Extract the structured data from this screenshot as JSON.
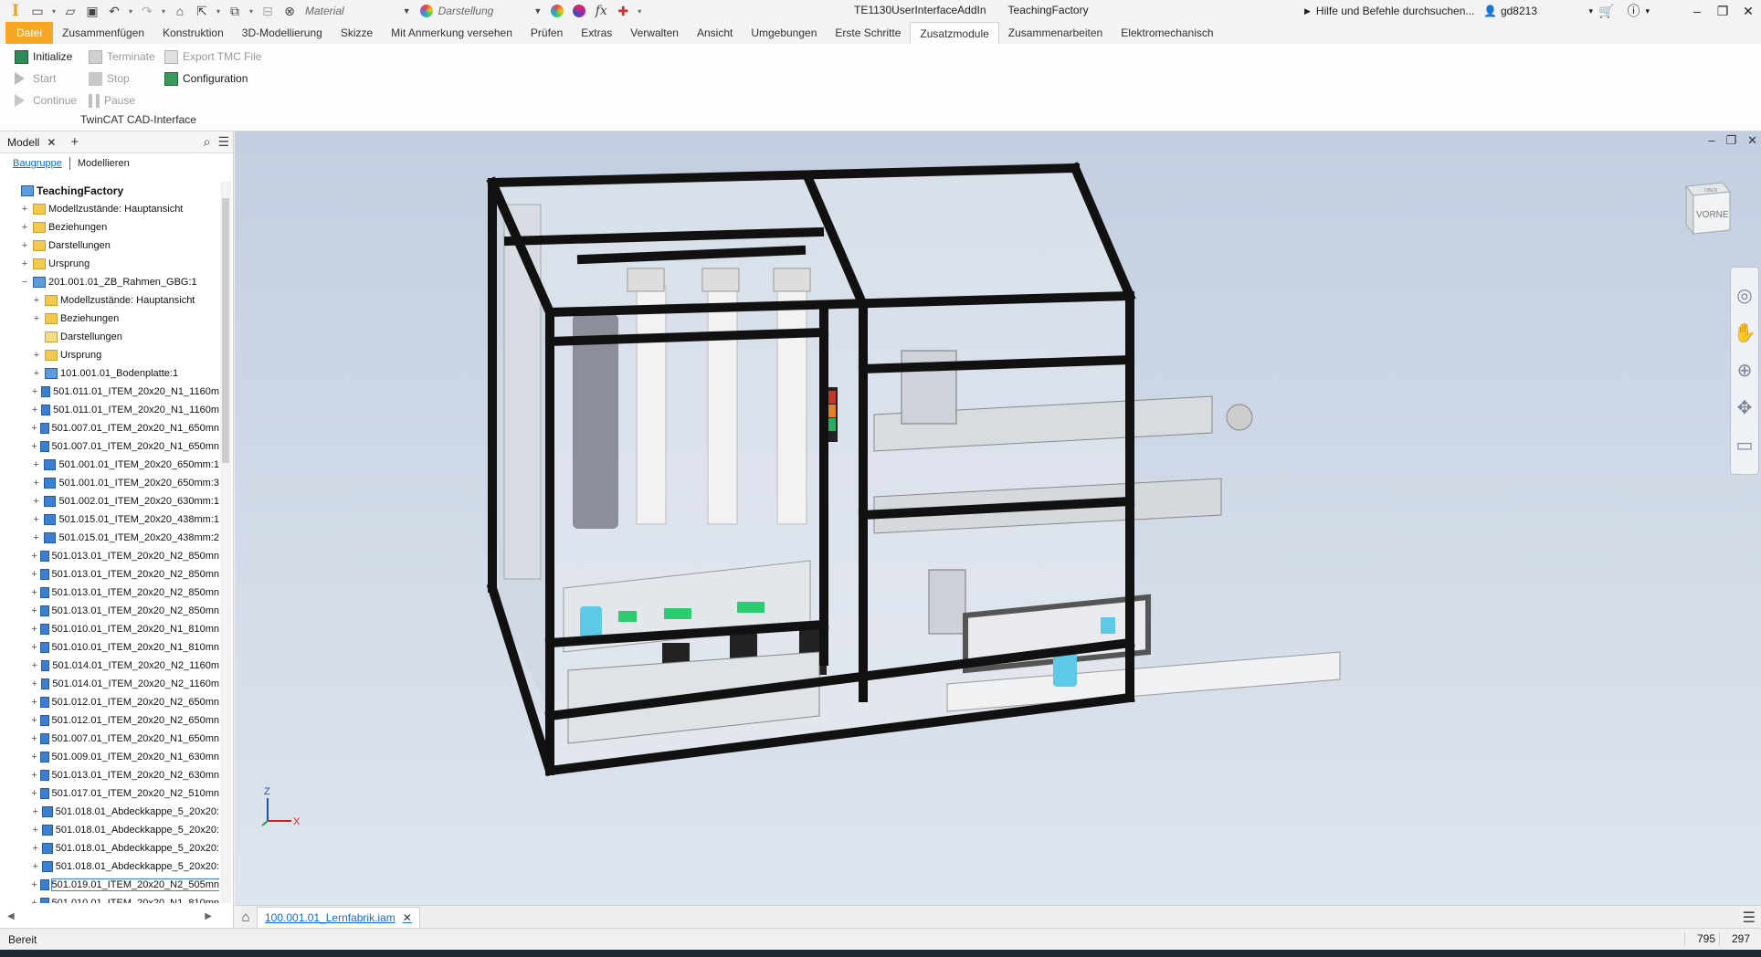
{
  "titlebar": {
    "material_label": "Material",
    "appearance_label": "Darstellung",
    "addin_name": "TE1130UserInterfaceAddIn",
    "document_title": "TeachingFactory",
    "help_search": "Hilfe und Befehle durchsuchen...",
    "user": "gd8213",
    "fx_label": "fx"
  },
  "menu": {
    "tabs": [
      "Datei",
      "Zusammenfügen",
      "Konstruktion",
      "3D-Modellierung",
      "Skizze",
      "Mit Anmerkung versehen",
      "Prüfen",
      "Extras",
      "Verwalten",
      "Ansicht",
      "Umgebungen",
      "Erste Schritte",
      "Zusatzmodule",
      "Zusammenarbeiten",
      "Elektromechanisch"
    ],
    "active": "Zusatzmodule"
  },
  "ribbon": {
    "initialize": "Initialize",
    "terminate": "Terminate",
    "export_tmc": "Export TMC File",
    "start": "Start",
    "stop": "Stop",
    "configuration": "Configuration",
    "continue": "Continue",
    "pause": "Pause",
    "group_label": "TwinCAT CAD-Interface"
  },
  "panel": {
    "tab_label": "Modell",
    "subtab_assembly": "Baugruppe",
    "subtab_modeling": "Modellieren",
    "tree": [
      {
        "label": "TeachingFactory",
        "level": 0,
        "icon": "asm",
        "exp": "",
        "root": true
      },
      {
        "label": "Modellzustände: Hauptansicht",
        "level": 1,
        "icon": "folder",
        "exp": "+"
      },
      {
        "label": "Beziehungen",
        "level": 1,
        "icon": "folder",
        "exp": "+"
      },
      {
        "label": "Darstellungen",
        "level": 1,
        "icon": "folder",
        "exp": "+"
      },
      {
        "label": "Ursprung",
        "level": 1,
        "icon": "folder",
        "exp": "+"
      },
      {
        "label": "201.001.01_ZB_Rahmen_GBG:1",
        "level": 1,
        "icon": "asm",
        "exp": "−"
      },
      {
        "label": "Modellzustände: Hauptansicht",
        "level": 2,
        "icon": "folder",
        "exp": "+"
      },
      {
        "label": "Beziehungen",
        "level": 2,
        "icon": "folder",
        "exp": "+"
      },
      {
        "label": "Darstellungen",
        "level": 2,
        "icon": "folder-empty",
        "exp": ""
      },
      {
        "label": "Ursprung",
        "level": 2,
        "icon": "folder",
        "exp": "+"
      },
      {
        "label": "101.001.01_Bodenplatte:1",
        "level": 2,
        "icon": "asm",
        "exp": "+"
      },
      {
        "label": "501.011.01_ITEM_20x20_N1_1160m",
        "level": 2,
        "icon": "part",
        "exp": "+"
      },
      {
        "label": "501.011.01_ITEM_20x20_N1_1160m",
        "level": 2,
        "icon": "part",
        "exp": "+"
      },
      {
        "label": "501.007.01_ITEM_20x20_N1_650mn",
        "level": 2,
        "icon": "part",
        "exp": "+"
      },
      {
        "label": "501.007.01_ITEM_20x20_N1_650mn",
        "level": 2,
        "icon": "part",
        "exp": "+"
      },
      {
        "label": "501.001.01_ITEM_20x20_650mm:1",
        "level": 2,
        "icon": "part",
        "exp": "+"
      },
      {
        "label": "501.001.01_ITEM_20x20_650mm:3",
        "level": 2,
        "icon": "part",
        "exp": "+"
      },
      {
        "label": "501.002.01_ITEM_20x20_630mm:1",
        "level": 2,
        "icon": "part",
        "exp": "+"
      },
      {
        "label": "501.015.01_ITEM_20x20_438mm:1",
        "level": 2,
        "icon": "part",
        "exp": "+"
      },
      {
        "label": "501.015.01_ITEM_20x20_438mm:2",
        "level": 2,
        "icon": "part",
        "exp": "+"
      },
      {
        "label": "501.013.01_ITEM_20x20_N2_850mn",
        "level": 2,
        "icon": "part",
        "exp": "+"
      },
      {
        "label": "501.013.01_ITEM_20x20_N2_850mn",
        "level": 2,
        "icon": "part",
        "exp": "+"
      },
      {
        "label": "501.013.01_ITEM_20x20_N2_850mn",
        "level": 2,
        "icon": "part",
        "exp": "+"
      },
      {
        "label": "501.013.01_ITEM_20x20_N2_850mn",
        "level": 2,
        "icon": "part",
        "exp": "+"
      },
      {
        "label": "501.010.01_ITEM_20x20_N1_810mn",
        "level": 2,
        "icon": "part",
        "exp": "+"
      },
      {
        "label": "501.010.01_ITEM_20x20_N1_810mn",
        "level": 2,
        "icon": "part",
        "exp": "+"
      },
      {
        "label": "501.014.01_ITEM_20x20_N2_1160m",
        "level": 2,
        "icon": "part",
        "exp": "+"
      },
      {
        "label": "501.014.01_ITEM_20x20_N2_1160m",
        "level": 2,
        "icon": "part",
        "exp": "+"
      },
      {
        "label": "501.012.01_ITEM_20x20_N2_650mn",
        "level": 2,
        "icon": "part",
        "exp": "+"
      },
      {
        "label": "501.012.01_ITEM_20x20_N2_650mn",
        "level": 2,
        "icon": "part",
        "exp": "+"
      },
      {
        "label": "501.007.01_ITEM_20x20_N1_650mn",
        "level": 2,
        "icon": "part",
        "exp": "+"
      },
      {
        "label": "501.009.01_ITEM_20x20_N1_630mn",
        "level": 2,
        "icon": "part",
        "exp": "+"
      },
      {
        "label": "501.013.01_ITEM_20x20_N2_630mn",
        "level": 2,
        "icon": "part",
        "exp": "+"
      },
      {
        "label": "501.017.01_ITEM_20x20_N2_510mn",
        "level": 2,
        "icon": "part",
        "exp": "+"
      },
      {
        "label": "501.018.01_Abdeckkappe_5_20x20:",
        "level": 2,
        "icon": "part",
        "exp": "+"
      },
      {
        "label": "501.018.01_Abdeckkappe_5_20x20:",
        "level": 2,
        "icon": "part",
        "exp": "+"
      },
      {
        "label": "501.018.01_Abdeckkappe_5_20x20:",
        "level": 2,
        "icon": "part",
        "exp": "+"
      },
      {
        "label": "501.018.01_Abdeckkappe_5_20x20:",
        "level": 2,
        "icon": "part",
        "exp": "+"
      },
      {
        "label": "501.019.01_ITEM_20x20_N2_505mn",
        "level": 2,
        "icon": "part",
        "exp": "+",
        "selected": true
      },
      {
        "label": "501.010.01_ITEM_20x20_N1_810mn",
        "level": 2,
        "icon": "part",
        "exp": "+"
      }
    ]
  },
  "viewport": {
    "viewcube_front": "VORNE",
    "viewcube_top": "OBEN",
    "axis_x": "X",
    "axis_z": "Z"
  },
  "docbar": {
    "tab_label": "100.001.01_Lernfabrik.iam"
  },
  "status": {
    "text": "Bereit",
    "coord_x": "795",
    "coord_y": "297"
  },
  "colors": {
    "file_tab": "#f5a623",
    "accent_blue": "#0a6fd6",
    "frame": "#111111",
    "viewport_top": "#c3cee0"
  }
}
